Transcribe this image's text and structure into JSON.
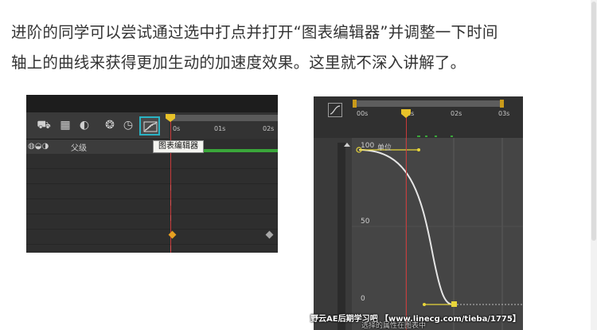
{
  "article": {
    "line1": "进阶的同学可以尝试通过选中打点并打开“图表编辑器”并调整一下时间",
    "line2": "轴上的曲线来获得更加生动的加速度效果。这里就不深入讲解了。"
  },
  "left_screenshot": {
    "ticks": [
      "0s",
      "01s",
      "02s"
    ],
    "parent_label": "父级",
    "tooltip": "图表编辑器",
    "highlight_color": "#2ab3c4"
  },
  "right_screenshot": {
    "ticks": [
      "00s",
      "01s",
      "02s",
      "03s"
    ],
    "axis_top": "100",
    "axis_unit": "单位",
    "axis_mid": "50",
    "axis_bottom": "0"
  },
  "watermark": {
    "text": "野云AE后期学习吧 【www.linecg.com/tieba/1775】",
    "sub": "选择的属性在图表中"
  },
  "colors": {
    "text": "#333333",
    "playhead": "#c83a3a",
    "keyframe": "#e8c229",
    "curve": "#e6e6e6"
  }
}
